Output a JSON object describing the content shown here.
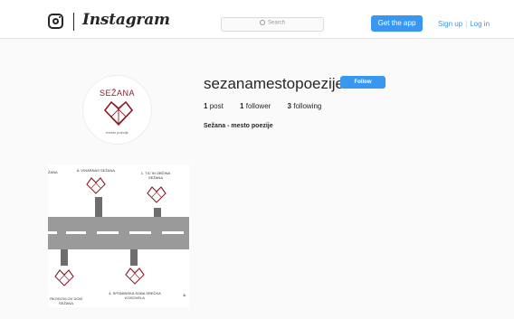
{
  "header": {
    "brand": "Instagram",
    "search_placeholder": "Search",
    "get_app_label": "Get the app",
    "signup_label": "Sign up",
    "divider": "|",
    "login_label": "Log in"
  },
  "profile": {
    "username": "sezanamestopoezije",
    "follow_label": "Follow",
    "posts_count": "1",
    "posts_label": "post",
    "followers_count": "1",
    "followers_label": "follower",
    "following_count": "3",
    "following_label": "following",
    "full_name": "Sežana - mesto poezije",
    "avatar": {
      "title": "SEŽANA",
      "subtitle": "mesto poezije"
    }
  },
  "post": {
    "labels": {
      "l0": "ŽANA",
      "l1": "8. VINARNAS SEŽANA",
      "l2": "1. TIC IN OBČINA SEŽANA",
      "l3": "RKOSOVLOV DOM SEŽANA",
      "l4": "4. SPOMINSKA SOBA SREČKA KOSOVELA",
      "l5": "3."
    }
  },
  "colors": {
    "accent": "#3897f0",
    "heart": "#8a1f2b"
  }
}
